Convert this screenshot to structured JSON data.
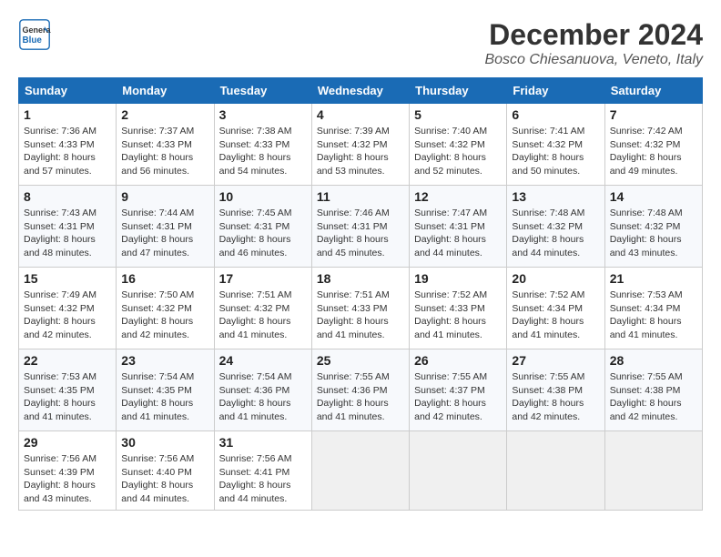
{
  "header": {
    "logo_line1": "General",
    "logo_line2": "Blue",
    "month_title": "December 2024",
    "location": "Bosco Chiesanuova, Veneto, Italy"
  },
  "weekdays": [
    "Sunday",
    "Monday",
    "Tuesday",
    "Wednesday",
    "Thursday",
    "Friday",
    "Saturday"
  ],
  "weeks": [
    [
      {
        "day": "1",
        "info": "Sunrise: 7:36 AM\nSunset: 4:33 PM\nDaylight: 8 hours\nand 57 minutes."
      },
      {
        "day": "2",
        "info": "Sunrise: 7:37 AM\nSunset: 4:33 PM\nDaylight: 8 hours\nand 56 minutes."
      },
      {
        "day": "3",
        "info": "Sunrise: 7:38 AM\nSunset: 4:33 PM\nDaylight: 8 hours\nand 54 minutes."
      },
      {
        "day": "4",
        "info": "Sunrise: 7:39 AM\nSunset: 4:32 PM\nDaylight: 8 hours\nand 53 minutes."
      },
      {
        "day": "5",
        "info": "Sunrise: 7:40 AM\nSunset: 4:32 PM\nDaylight: 8 hours\nand 52 minutes."
      },
      {
        "day": "6",
        "info": "Sunrise: 7:41 AM\nSunset: 4:32 PM\nDaylight: 8 hours\nand 50 minutes."
      },
      {
        "day": "7",
        "info": "Sunrise: 7:42 AM\nSunset: 4:32 PM\nDaylight: 8 hours\nand 49 minutes."
      }
    ],
    [
      {
        "day": "8",
        "info": "Sunrise: 7:43 AM\nSunset: 4:31 PM\nDaylight: 8 hours\nand 48 minutes."
      },
      {
        "day": "9",
        "info": "Sunrise: 7:44 AM\nSunset: 4:31 PM\nDaylight: 8 hours\nand 47 minutes."
      },
      {
        "day": "10",
        "info": "Sunrise: 7:45 AM\nSunset: 4:31 PM\nDaylight: 8 hours\nand 46 minutes."
      },
      {
        "day": "11",
        "info": "Sunrise: 7:46 AM\nSunset: 4:31 PM\nDaylight: 8 hours\nand 45 minutes."
      },
      {
        "day": "12",
        "info": "Sunrise: 7:47 AM\nSunset: 4:31 PM\nDaylight: 8 hours\nand 44 minutes."
      },
      {
        "day": "13",
        "info": "Sunrise: 7:48 AM\nSunset: 4:32 PM\nDaylight: 8 hours\nand 44 minutes."
      },
      {
        "day": "14",
        "info": "Sunrise: 7:48 AM\nSunset: 4:32 PM\nDaylight: 8 hours\nand 43 minutes."
      }
    ],
    [
      {
        "day": "15",
        "info": "Sunrise: 7:49 AM\nSunset: 4:32 PM\nDaylight: 8 hours\nand 42 minutes."
      },
      {
        "day": "16",
        "info": "Sunrise: 7:50 AM\nSunset: 4:32 PM\nDaylight: 8 hours\nand 42 minutes."
      },
      {
        "day": "17",
        "info": "Sunrise: 7:51 AM\nSunset: 4:32 PM\nDaylight: 8 hours\nand 41 minutes."
      },
      {
        "day": "18",
        "info": "Sunrise: 7:51 AM\nSunset: 4:33 PM\nDaylight: 8 hours\nand 41 minutes."
      },
      {
        "day": "19",
        "info": "Sunrise: 7:52 AM\nSunset: 4:33 PM\nDaylight: 8 hours\nand 41 minutes."
      },
      {
        "day": "20",
        "info": "Sunrise: 7:52 AM\nSunset: 4:34 PM\nDaylight: 8 hours\nand 41 minutes."
      },
      {
        "day": "21",
        "info": "Sunrise: 7:53 AM\nSunset: 4:34 PM\nDaylight: 8 hours\nand 41 minutes."
      }
    ],
    [
      {
        "day": "22",
        "info": "Sunrise: 7:53 AM\nSunset: 4:35 PM\nDaylight: 8 hours\nand 41 minutes."
      },
      {
        "day": "23",
        "info": "Sunrise: 7:54 AM\nSunset: 4:35 PM\nDaylight: 8 hours\nand 41 minutes."
      },
      {
        "day": "24",
        "info": "Sunrise: 7:54 AM\nSunset: 4:36 PM\nDaylight: 8 hours\nand 41 minutes."
      },
      {
        "day": "25",
        "info": "Sunrise: 7:55 AM\nSunset: 4:36 PM\nDaylight: 8 hours\nand 41 minutes."
      },
      {
        "day": "26",
        "info": "Sunrise: 7:55 AM\nSunset: 4:37 PM\nDaylight: 8 hours\nand 42 minutes."
      },
      {
        "day": "27",
        "info": "Sunrise: 7:55 AM\nSunset: 4:38 PM\nDaylight: 8 hours\nand 42 minutes."
      },
      {
        "day": "28",
        "info": "Sunrise: 7:55 AM\nSunset: 4:38 PM\nDaylight: 8 hours\nand 42 minutes."
      }
    ],
    [
      {
        "day": "29",
        "info": "Sunrise: 7:56 AM\nSunset: 4:39 PM\nDaylight: 8 hours\nand 43 minutes."
      },
      {
        "day": "30",
        "info": "Sunrise: 7:56 AM\nSunset: 4:40 PM\nDaylight: 8 hours\nand 44 minutes."
      },
      {
        "day": "31",
        "info": "Sunrise: 7:56 AM\nSunset: 4:41 PM\nDaylight: 8 hours\nand 44 minutes."
      },
      null,
      null,
      null,
      null
    ]
  ]
}
